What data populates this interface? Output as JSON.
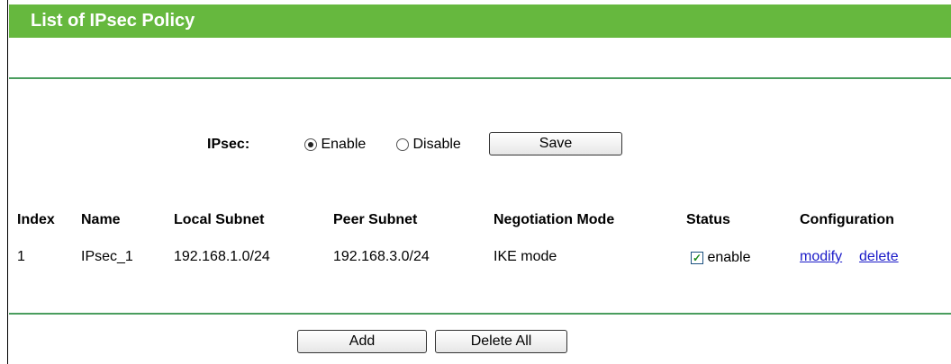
{
  "page_title": "List of IPsec Policy",
  "ipsec": {
    "label": "IPsec:",
    "options": [
      {
        "label": "Enable",
        "selected": true
      },
      {
        "label": "Disable",
        "selected": false
      }
    ],
    "save_label": "Save"
  },
  "table": {
    "columns": [
      "Index",
      "Name",
      "Local Subnet",
      "Peer Subnet",
      "Negotiation Mode",
      "Status",
      "Configuration"
    ],
    "rows": [
      {
        "index": "1",
        "name": "IPsec_1",
        "local_subnet": "192.168.1.0/24",
        "peer_subnet": "192.168.3.0/24",
        "negotiation_mode": "IKE mode",
        "status_checked": true,
        "status_label": "enable",
        "modify_label": "modify",
        "delete_label": "delete"
      }
    ]
  },
  "footer": {
    "add_label": "Add",
    "delete_all_label": "Delete All"
  },
  "colors": {
    "title_bar": "#66b83e",
    "divider": "#4a9d5e",
    "link": "#1a1ac8"
  }
}
